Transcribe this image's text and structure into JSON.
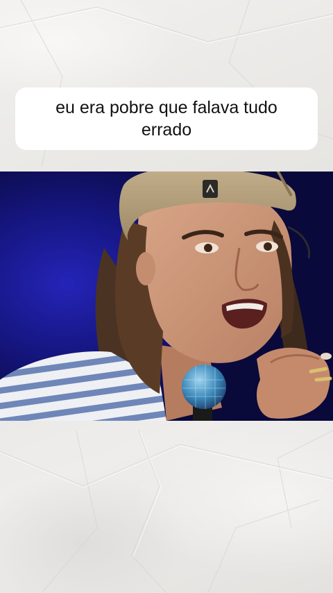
{
  "caption": {
    "text": "eu era pobre que falava tudo errado"
  },
  "video": {
    "icon": "video-frame-image"
  },
  "colors": {
    "background": "#ecebe8",
    "caption_bg": "#ffffff",
    "caption_text": "#111111",
    "stage_blue": "#141480"
  }
}
